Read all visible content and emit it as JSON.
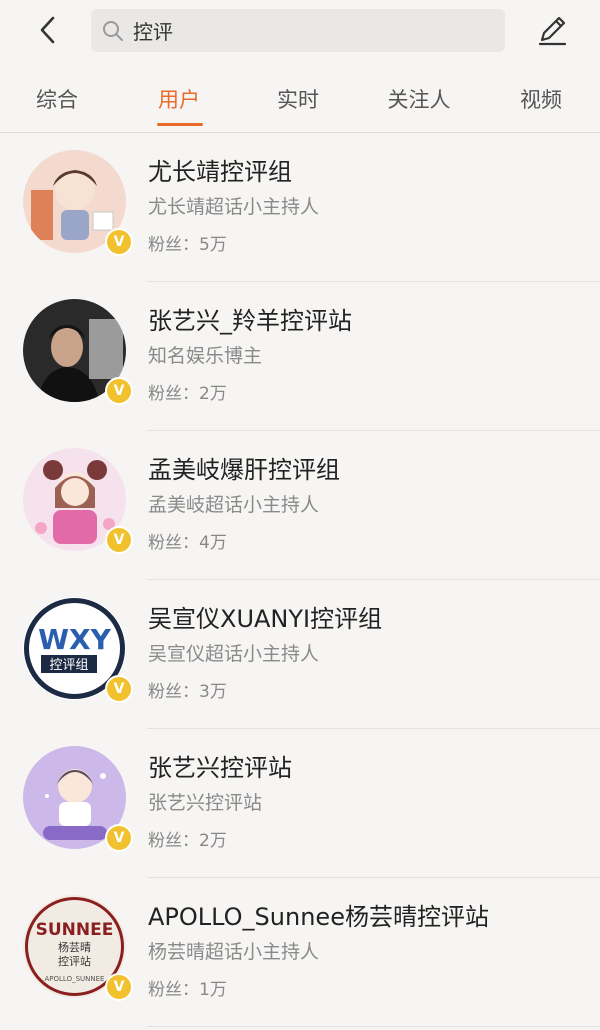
{
  "search": {
    "query": "控评"
  },
  "tabs": [
    {
      "label": "综合"
    },
    {
      "label": "用户",
      "active": true
    },
    {
      "label": "实时"
    },
    {
      "label": "关注人"
    },
    {
      "label": "视频"
    }
  ],
  "colors": {
    "accent": "#e96c2c",
    "verified": "#f2c12e"
  },
  "results": [
    {
      "name": "尤长靖控评组",
      "desc": "尤长靖超话小主持人",
      "fans": "粉丝：5万",
      "avatar_icon": "cartoon-boy-avatar",
      "verified": "V"
    },
    {
      "name": "张艺兴_羚羊控评站",
      "desc": "知名娱乐博主",
      "fans": "粉丝：2万",
      "avatar_icon": "photo-man-avatar",
      "verified": "V"
    },
    {
      "name": "孟美岐爆肝控评组",
      "desc": "孟美岐超话小主持人",
      "fans": "粉丝：4万",
      "avatar_icon": "cartoon-girl-avatar",
      "verified": "V"
    },
    {
      "name": "吴宣仪XUANYI控评组",
      "desc": "吴宣仪超话小主持人",
      "fans": "粉丝：3万",
      "avatar_icon": "wxy-logo-avatar",
      "verified": "V",
      "avatar_text_top": "WXY",
      "avatar_text_bottom": "控评组"
    },
    {
      "name": "张艺兴控评站",
      "desc": "张艺兴控评站",
      "fans": "粉丝：2万",
      "avatar_icon": "cartoon-boy-purple-avatar",
      "verified": "V"
    },
    {
      "name": "APOLLO_Sunnee杨芸晴控评站",
      "desc": "杨芸晴超话小主持人",
      "fans": "粉丝：1万",
      "avatar_icon": "sunnee-logo-avatar",
      "verified": "V",
      "avatar_text_top": "SUNNEE",
      "avatar_text_sub": "杨芸晴",
      "avatar_text_sub2": "控评站",
      "avatar_text_bottom": "APOLLO_SUNNEE"
    }
  ]
}
